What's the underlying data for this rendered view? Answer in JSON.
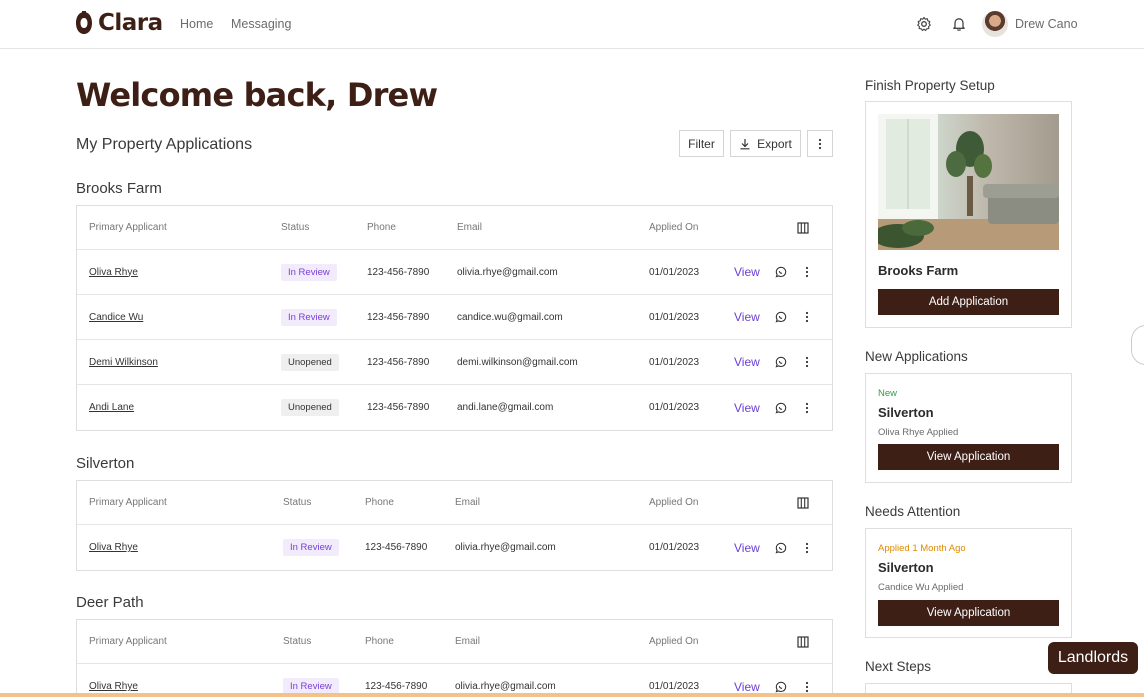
{
  "header": {
    "logo_text": "Clara",
    "nav": [
      "Home",
      "Messaging"
    ],
    "user_name": "Drew Cano",
    "icons": [
      "gear-icon",
      "bell-icon"
    ]
  },
  "main": {
    "welcome": "Welcome back, Drew",
    "section_title": "My Property Applications",
    "filter_label": "Filter",
    "export_label": "Export",
    "columns": [
      "Primary Applicant",
      "Status",
      "Phone",
      "Email",
      "Applied On"
    ],
    "view_label": "View",
    "properties": [
      {
        "name": "Brooks Farm",
        "rows": [
          {
            "applicant": "Oliva Rhye",
            "status": "In Review",
            "phone": "123-456-7890",
            "email": "olivia.rhye@gmail.com",
            "applied": "01/01/2023"
          },
          {
            "applicant": "Candice Wu",
            "status": "In Review",
            "phone": "123-456-7890",
            "email": "candice.wu@gmail.com",
            "applied": "01/01/2023"
          },
          {
            "applicant": "Demi Wilkinson",
            "status": "Unopened",
            "phone": "123-456-7890",
            "email": "demi.wilkinson@gmail.com",
            "applied": "01/01/2023"
          },
          {
            "applicant": "Andi Lane",
            "status": "Unopened",
            "phone": "123-456-7890",
            "email": "andi.lane@gmail.com",
            "applied": "01/01/2023"
          }
        ]
      },
      {
        "name": "Silverton",
        "rows": [
          {
            "applicant": "Oliva Rhye",
            "status": "In Review",
            "phone": "123-456-7890",
            "email": "olivia.rhye@gmail.com",
            "applied": "01/01/2023"
          }
        ]
      },
      {
        "name": "Deer Path",
        "rows": [
          {
            "applicant": "Oliva Rhye",
            "status": "In Review",
            "phone": "123-456-7890",
            "email": "olivia.rhye@gmail.com",
            "applied": "01/01/2023"
          }
        ]
      }
    ]
  },
  "sidebar": {
    "setup_title": "Finish Property Setup",
    "setup_property": "Brooks Farm",
    "setup_button": "Add Application",
    "new_title": "New Applications",
    "new_tag": "New",
    "new_property": "Silverton",
    "new_applicant": "Oliva Rhye Applied",
    "new_button": "View Application",
    "attention_title": "Needs Attention",
    "attention_tag": "Applied 1 Month Ago",
    "attention_property": "Silverton",
    "attention_applicant": "Candice Wu Applied",
    "attention_button": "View Application",
    "next_title": "Next Steps"
  },
  "floating_label": "Landlords",
  "colors": {
    "brand": "#3e1f16",
    "review_text": "#7a3fd8",
    "review_bg": "#f1ebfb",
    "link": "#6b3fd4",
    "new_tag": "#2f9e44",
    "attention_tag": "#e08a00"
  }
}
